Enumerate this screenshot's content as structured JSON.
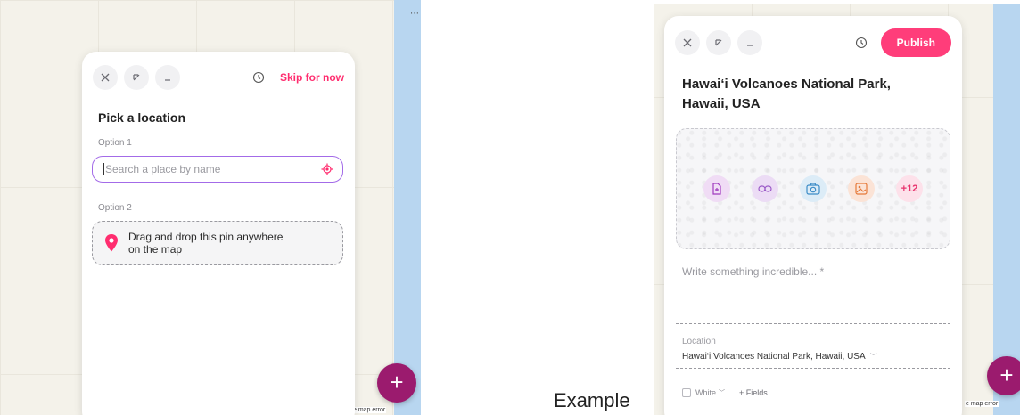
{
  "left_screen": {
    "map_error": "e map error",
    "fab_label": "+",
    "card": {
      "skip_label": "Skip for now",
      "title": "Pick a location",
      "option1_label": "Option 1",
      "search_placeholder": "Search a place by name",
      "option2_label": "Option 2",
      "drop_text_line1": "Drag and drop this pin anywhere",
      "drop_text_line2": "on the map"
    }
  },
  "caption": "Example",
  "right_screen": {
    "map_error": "e map error",
    "fab_label": "+",
    "card": {
      "publish_label": "Publish",
      "title_line1": "Hawai‘i Volcanoes National Park,",
      "title_line2": "Hawaii, USA",
      "media_more": "+12",
      "write_placeholder": "Write something incredible... *",
      "location_label": "Location",
      "location_value": "Hawai‘i Volcanoes National Park, Hawaii, USA",
      "white_label": "White",
      "fields_label": "+ Fields"
    }
  },
  "colors": {
    "accent_pink": "#ff2d6f",
    "publish_pink": "#ff3d7a",
    "fab_purple": "#9b1b6e",
    "input_focus": "#a36be8",
    "water": "#b8d6f0"
  },
  "icons": [
    "close-icon",
    "expand-icon",
    "minimize-icon",
    "clock-icon",
    "target-icon",
    "pin-icon",
    "file-icon",
    "link-icon",
    "camera-icon",
    "image-icon",
    "chevron-down-icon"
  ]
}
